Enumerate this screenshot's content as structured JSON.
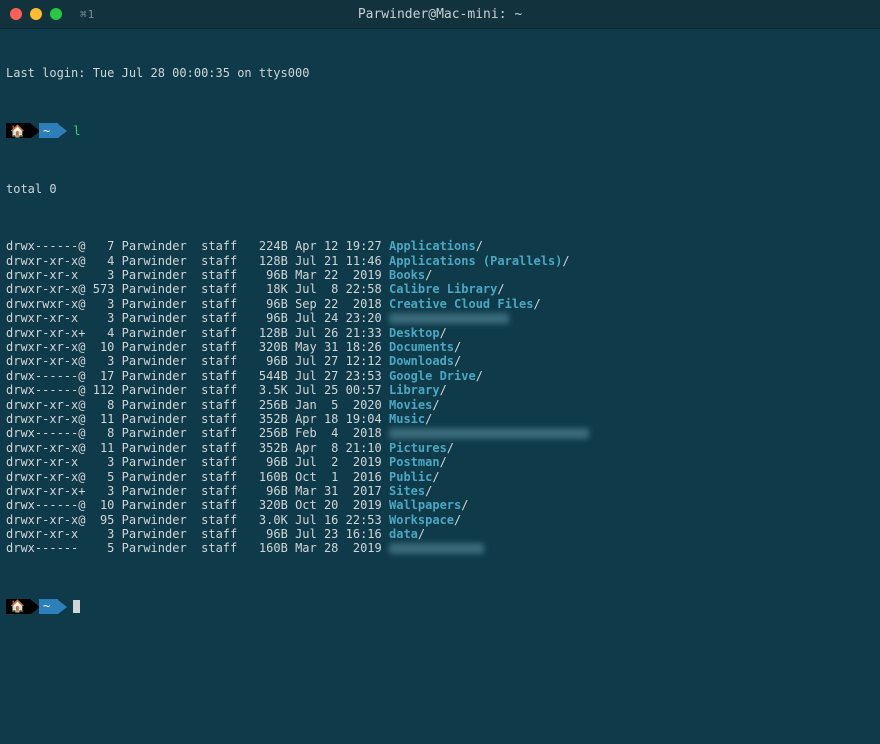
{
  "window": {
    "title": "Parwinder@Mac-mini: ~",
    "tab_icon": "⌘1"
  },
  "last_login": "Last login: Tue Jul 28 00:00:35 on ttys000",
  "prompt": {
    "seg1": "🏠",
    "seg2": "~",
    "command": "l"
  },
  "total": "total 0",
  "rows": [
    {
      "perm": "drwx------@",
      "link": "  7",
      "owner": "Parwinder",
      "group": "staff",
      "size": " 224B",
      "date": "Apr 12 19:27",
      "name": "Applications",
      "blur": 0
    },
    {
      "perm": "drwxr-xr-x@",
      "link": "  4",
      "owner": "Parwinder",
      "group": "staff",
      "size": " 128B",
      "date": "Jul 21 11:46",
      "name": "Applications (Parallels)",
      "blur": 0
    },
    {
      "perm": "drwxr-xr-x ",
      "link": "  3",
      "owner": "Parwinder",
      "group": "staff",
      "size": "  96B",
      "date": "Mar 22  2019",
      "name": "Books",
      "blur": 0
    },
    {
      "perm": "drwxr-xr-x@",
      "link": "573",
      "owner": "Parwinder",
      "group": "staff",
      "size": "  18K",
      "date": "Jul  8 22:58",
      "name": "Calibre Library",
      "blur": 0
    },
    {
      "perm": "drwxrwxr-x@",
      "link": "  3",
      "owner": "Parwinder",
      "group": "staff",
      "size": "  96B",
      "date": "Sep 22  2018",
      "name": "Creative Cloud Files",
      "blur": 0
    },
    {
      "perm": "drwxr-xr-x ",
      "link": "  3",
      "owner": "Parwinder",
      "group": "staff",
      "size": "  96B",
      "date": "Jul 24 23:20",
      "name": "",
      "blur": 120
    },
    {
      "perm": "drwxr-xr-x+",
      "link": "  4",
      "owner": "Parwinder",
      "group": "staff",
      "size": " 128B",
      "date": "Jul 26 21:33",
      "name": "Desktop",
      "blur": 0
    },
    {
      "perm": "drwxr-xr-x@",
      "link": " 10",
      "owner": "Parwinder",
      "group": "staff",
      "size": " 320B",
      "date": "May 31 18:26",
      "name": "Documents",
      "blur": 0
    },
    {
      "perm": "drwxr-xr-x@",
      "link": "  3",
      "owner": "Parwinder",
      "group": "staff",
      "size": "  96B",
      "date": "Jul 27 12:12",
      "name": "Downloads",
      "blur": 0
    },
    {
      "perm": "drwx------@",
      "link": " 17",
      "owner": "Parwinder",
      "group": "staff",
      "size": " 544B",
      "date": "Jul 27 23:53",
      "name": "Google Drive",
      "blur": 0
    },
    {
      "perm": "drwx------@",
      "link": "112",
      "owner": "Parwinder",
      "group": "staff",
      "size": " 3.5K",
      "date": "Jul 25 00:57",
      "name": "Library",
      "blur": 0
    },
    {
      "perm": "drwxr-xr-x@",
      "link": "  8",
      "owner": "Parwinder",
      "group": "staff",
      "size": " 256B",
      "date": "Jan  5  2020",
      "name": "Movies",
      "blur": 0
    },
    {
      "perm": "drwxr-xr-x@",
      "link": " 11",
      "owner": "Parwinder",
      "group": "staff",
      "size": " 352B",
      "date": "Apr 18 19:04",
      "name": "Music",
      "blur": 0
    },
    {
      "perm": "drwx------@",
      "link": "  8",
      "owner": "Parwinder",
      "group": "staff",
      "size": " 256B",
      "date": "Feb  4  2018",
      "name": "",
      "blur": 200
    },
    {
      "perm": "drwxr-xr-x@",
      "link": " 11",
      "owner": "Parwinder",
      "group": "staff",
      "size": " 352B",
      "date": "Apr  8 21:10",
      "name": "Pictures",
      "blur": 0
    },
    {
      "perm": "drwxr-xr-x ",
      "link": "  3",
      "owner": "Parwinder",
      "group": "staff",
      "size": "  96B",
      "date": "Jul  2  2019",
      "name": "Postman",
      "blur": 0
    },
    {
      "perm": "drwxr-xr-x@",
      "link": "  5",
      "owner": "Parwinder",
      "group": "staff",
      "size": " 160B",
      "date": "Oct  1  2016",
      "name": "Public",
      "blur": 0
    },
    {
      "perm": "drwxr-xr-x+",
      "link": "  3",
      "owner": "Parwinder",
      "group": "staff",
      "size": "  96B",
      "date": "Mar 31  2017",
      "name": "Sites",
      "blur": 0
    },
    {
      "perm": "drwx------@",
      "link": " 10",
      "owner": "Parwinder",
      "group": "staff",
      "size": " 320B",
      "date": "Oct 20  2019",
      "name": "Wallpapers",
      "blur": 0
    },
    {
      "perm": "drwxr-xr-x@",
      "link": " 95",
      "owner": "Parwinder",
      "group": "staff",
      "size": " 3.0K",
      "date": "Jul 16 22:53",
      "name": "Workspace",
      "blur": 0
    },
    {
      "perm": "drwxr-xr-x ",
      "link": "  3",
      "owner": "Parwinder",
      "group": "staff",
      "size": "  96B",
      "date": "Jul 23 16:16",
      "name": "data",
      "blur": 0
    },
    {
      "perm": "drwx------ ",
      "link": "  5",
      "owner": "Parwinder",
      "group": "staff",
      "size": " 160B",
      "date": "Mar 28  2019",
      "name": "",
      "blur": 95
    }
  ]
}
